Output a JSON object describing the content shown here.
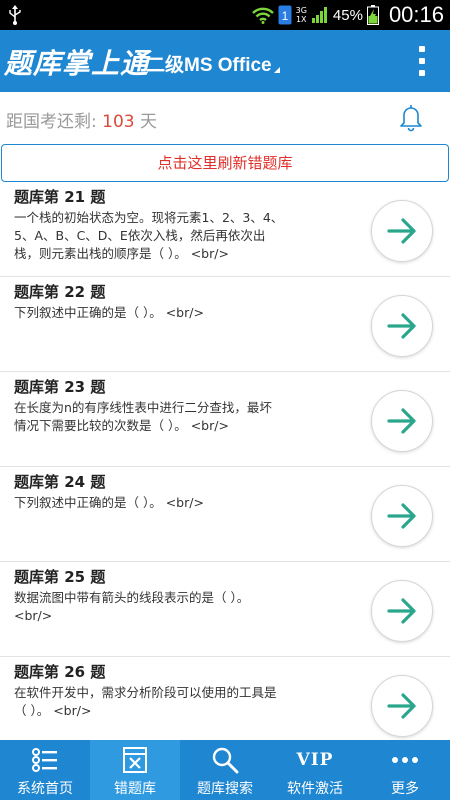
{
  "status_bar": {
    "network_label_top": "3G",
    "network_label_bottom": "1X",
    "sim_label": "1",
    "battery_percent": "45%",
    "time": "00:16"
  },
  "header": {
    "app_title": "题库掌上通",
    "subject": "二级MS Office"
  },
  "countdown": {
    "prefix": "距国考还剩: ",
    "days": "103",
    "suffix": " 天"
  },
  "refresh_label": "点击这里刷新错题库",
  "questions": [
    {
      "title": "题库第  21 题",
      "body": "一个栈的初始状态为空。现将元素1、2、3、4、5、A、B、C、D、E依次入栈，然后再依次出栈，则元素出栈的顺序是（  ）。 <br/>"
    },
    {
      "title": "题库第  22 题",
      "body": "下列叙述中正确的是（  ）。 <br/>"
    },
    {
      "title": "题库第  23 题",
      "body": "在长度为n的有序线性表中进行二分查找，最坏情况下需要比较的次数是（  ）。 <br/>"
    },
    {
      "title": "题库第  24 题",
      "body": "下列叙述中正确的是（  ）。 <br/>"
    },
    {
      "title": "题库第  25 题",
      "body": "数据流图中带有箭头的线段表示的是（  ）。 <br/>"
    },
    {
      "title": "题库第  26 题",
      "body": "在软件开发中，需求分析阶段可以使用的工具是（  ）。 <br/>"
    }
  ],
  "nav": [
    {
      "label": "系统首页",
      "icon": "list-icon"
    },
    {
      "label": "错题库",
      "icon": "wrong-book-icon"
    },
    {
      "label": "题库搜索",
      "icon": "search-icon"
    },
    {
      "label": "软件激活",
      "icon": "vip-icon",
      "icon_text": "VIP"
    },
    {
      "label": "更多",
      "icon": "more-icon"
    }
  ],
  "colors": {
    "primary": "#1f86d1",
    "arrow": "#2aa68c",
    "accent_red": "#e0302a"
  }
}
